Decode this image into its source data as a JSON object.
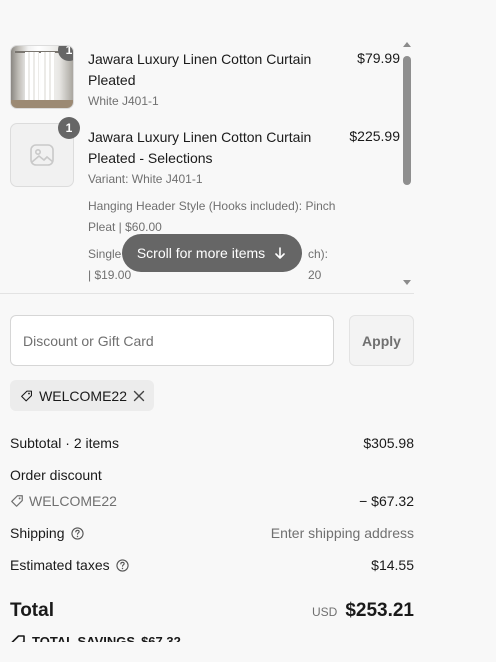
{
  "cart": {
    "items": [
      {
        "quantity": "1",
        "title": "Jawara Luxury Linen Cotton Curtain Pleated",
        "variant": "White J401-1",
        "price": "$79.99",
        "image": "curtain-photo"
      },
      {
        "quantity": "1",
        "title": "Jawara Luxury Linen Cotton Curtain Pleated - Selections",
        "variant": "Variant: White J401-1",
        "price": "$225.99",
        "image": "image-placeholder-icon",
        "options": [
          "Hanging Header Style (Hooks included): Pinch Pleat | $60.00",
          "Single",
          "ch): 20",
          "| $19.00"
        ]
      }
    ],
    "scroll_hint": "Scroll for more items",
    "scroll_hint_icon": "arrow-down-icon"
  },
  "discount": {
    "placeholder": "Discount or Gift Card",
    "apply_label": "Apply",
    "applied_code": "WELCOME22"
  },
  "summary": {
    "subtotal_label": "Subtotal · 2 items",
    "subtotal_value": "$305.98",
    "order_discount_label": "Order discount",
    "discount_code": "WELCOME22",
    "discount_value": "− $67.32",
    "shipping_label": "Shipping",
    "shipping_value": "Enter shipping address",
    "taxes_label": "Estimated taxes",
    "taxes_value": "$14.55",
    "total_label": "Total",
    "currency": "USD",
    "total_value": "$253.21",
    "savings_label": "TOTAL SAVINGS",
    "savings_value": "$67.32"
  },
  "colors": {
    "background": "#f8f8f8",
    "badge": "#666666",
    "muted_text": "#707070",
    "border": "#d6d6d6"
  }
}
